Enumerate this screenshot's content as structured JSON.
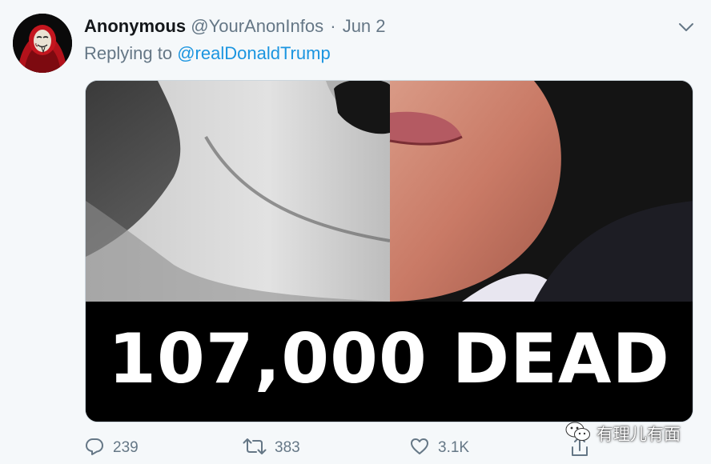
{
  "tweet": {
    "author_name": "Anonymous",
    "author_handle": "@YourAnonInfos",
    "separator": "·",
    "date": "Jun 2",
    "reply_prefix": "Replying to",
    "reply_to": "@realDonaldTrump",
    "media_caption": "107,000 DEAD"
  },
  "actions": {
    "reply_count": "239",
    "retweet_count": "383",
    "like_count": "3.1K"
  },
  "watermark": {
    "text": "有理儿有面"
  },
  "colors": {
    "name": "#14171a",
    "secondary_text": "#657786",
    "link": "#1b95e0",
    "background": "#f5f8fa"
  },
  "icons": [
    "avatar-anonymous-mask",
    "chevron-down-icon",
    "reply-icon",
    "retweet-icon",
    "like-icon",
    "share-icon",
    "wechat-icon"
  ]
}
